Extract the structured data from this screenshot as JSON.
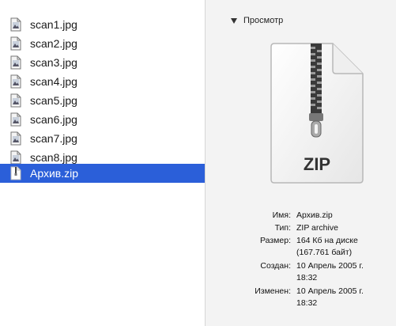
{
  "files": [
    {
      "name": "scan1.jpg",
      "icon": "jpg-image-icon",
      "selected": false
    },
    {
      "name": "scan2.jpg",
      "icon": "jpg-image-icon",
      "selected": false
    },
    {
      "name": "scan3.jpg",
      "icon": "jpg-image-icon",
      "selected": false
    },
    {
      "name": "scan4.jpg",
      "icon": "jpg-image-icon",
      "selected": false
    },
    {
      "name": "scan5.jpg",
      "icon": "jpg-image-icon",
      "selected": false
    },
    {
      "name": "scan6.jpg",
      "icon": "jpg-image-icon",
      "selected": false
    },
    {
      "name": "scan7.jpg",
      "icon": "jpg-image-icon",
      "selected": false
    },
    {
      "name": "scan8.jpg",
      "icon": "jpg-image-icon",
      "selected": false
    },
    {
      "name": "Архив.zip",
      "icon": "zip-archive-icon",
      "selected": true
    }
  ],
  "preview": {
    "header": "Просмотр",
    "badge": "ZIP",
    "info": [
      {
        "label": "Имя:",
        "lines": [
          "Архив.zip"
        ]
      },
      {
        "label": "Тип:",
        "lines": [
          "ZIP archive"
        ]
      },
      {
        "label": "Размер:",
        "lines": [
          "164 Кб на диске",
          "(167.761 байт)"
        ]
      },
      {
        "label": "Создан:",
        "lines": [
          "10 Апрель 2005 г.",
          "18:32"
        ]
      },
      {
        "label": "Изменен:",
        "lines": [
          "10 Апрель 2005 г.",
          "18:32"
        ]
      }
    ]
  },
  "colors": {
    "selection": "#2b5fd9",
    "panel_bg": "#f3f3f3"
  }
}
